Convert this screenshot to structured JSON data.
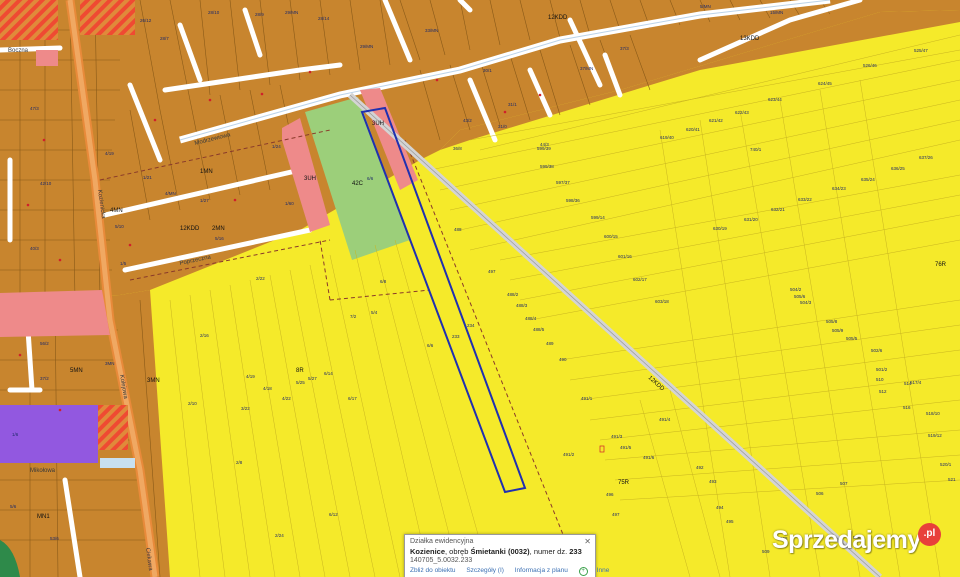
{
  "map": {
    "zones": {
      "zone_42c": "42C",
      "zone_3uh_a": "3UH",
      "zone_3uh_b": "3UH",
      "zone_1mn": "1MN",
      "zone_2mn": "2MN",
      "zone_3mn": "3MN",
      "zone_4mn": "4MN",
      "zone_5mn": "5MN",
      "zone_mn1": "MN1",
      "zone_75r": "75R",
      "zone_76r": "76R",
      "zone_8r": "8R",
      "zone_12kdd": "12KDD",
      "zone_13kdd": "13KDD",
      "zone_12kdd_lower": "12KDD",
      "zone_12kdd_diag": "12KDD"
    },
    "parcels": [
      "599/39",
      "599/38",
      "597/37",
      "598/36",
      "599/14",
      "600/15",
      "601/16",
      "602/17",
      "603/18",
      "624/45",
      "623/44",
      "622/43",
      "621/42",
      "620/41",
      "619/40",
      "740/1",
      "630/19",
      "631/20",
      "632/21",
      "633/22",
      "634/23",
      "635/24",
      "636/25",
      "637/26",
      "525/47",
      "638/26",
      "488/2",
      "488/3",
      "488/4",
      "488/5",
      "489",
      "490",
      "491/1",
      "491/2",
      "491/3",
      "491/4",
      "491/5",
      "491/6",
      "492",
      "493",
      "494",
      "495",
      "496",
      "497",
      "498",
      "499",
      "234",
      "233",
      "2/22",
      "2/3",
      "2/10",
      "2/8",
      "2/24",
      "3/22",
      "4/19",
      "4/18",
      "4/22",
      "5/25",
      "5/27",
      "6/14",
      "6/17",
      "6/12",
      "7/2",
      "5/4",
      "6/8",
      "1/1",
      "505/8",
      "505/9",
      "505/6",
      "505/5",
      "504/3",
      "504/2",
      "503/8",
      "502/6",
      "501/2",
      "510",
      "512",
      "514",
      "516",
      "517/4",
      "518/10",
      "519/12",
      "520/1",
      "521",
      "506",
      "507",
      "508",
      "509"
    ],
    "roads": {
      "road_a": "Kozienicka",
      "road_b": "Kolejowa",
      "road_c": "Boczna",
      "road_d": "Mikołowa",
      "road_e": "Modrzewiowa",
      "road_f": "Poprzeczna",
      "road_g": "Ciekawa"
    }
  },
  "popup": {
    "header": "Działka ewidencyjna",
    "location": "Kozienice",
    "precinct_text": ", obręb ",
    "precinct": "Śmietanki (0032)",
    "number_text": ", numer dz. ",
    "number": "233",
    "identifier": "140705_5.0032.233",
    "link_zoom": "Zbliż do obiektu",
    "link_details": "Szczegóły (I)",
    "link_plan": "Informacja z planu",
    "link_other": "Inne",
    "close_symbol": "✕"
  },
  "watermark": {
    "text": "Sprzedajemy",
    "badge": ".pl"
  },
  "colors": {
    "agricultural_yellow": "#f5ea2a",
    "residential_brown": "#c8852e",
    "service_pink": "#ee8a8a",
    "green_zone": "#9ccf7a",
    "industrial_purple": "#9258e0",
    "road_orange": "#e88a3a",
    "selection_blue": "#2030b0"
  }
}
